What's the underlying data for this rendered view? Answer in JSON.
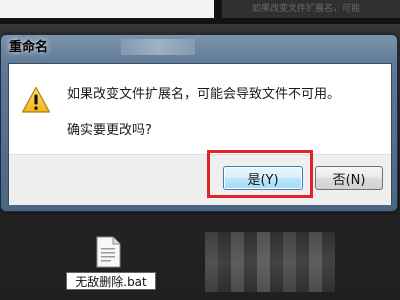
{
  "background_window": {
    "faded_text": "如果改变文件扩展名，可能"
  },
  "dialog": {
    "title": "重命名",
    "message": "如果改变文件扩展名，可能会导致文件不可用。",
    "question": "确实要更改吗?",
    "icon": "warning-icon",
    "buttons": {
      "yes_label": "是(Y)",
      "no_label": "否(N)"
    },
    "highlight_color": "#e0242b"
  },
  "desktop": {
    "file_icon": "document-icon",
    "file_name": "无敌删除.bat"
  }
}
